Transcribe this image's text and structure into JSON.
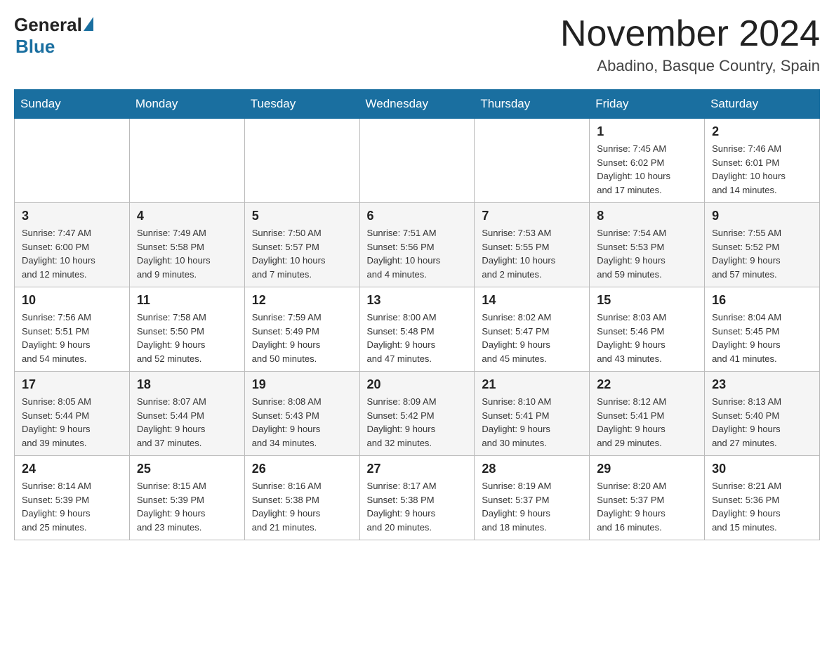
{
  "header": {
    "logo_general": "General",
    "logo_blue": "Blue",
    "month_title": "November 2024",
    "location": "Abadino, Basque Country, Spain"
  },
  "weekdays": [
    "Sunday",
    "Monday",
    "Tuesday",
    "Wednesday",
    "Thursday",
    "Friday",
    "Saturday"
  ],
  "rows": [
    [
      {
        "day": "",
        "info": ""
      },
      {
        "day": "",
        "info": ""
      },
      {
        "day": "",
        "info": ""
      },
      {
        "day": "",
        "info": ""
      },
      {
        "day": "",
        "info": ""
      },
      {
        "day": "1",
        "info": "Sunrise: 7:45 AM\nSunset: 6:02 PM\nDaylight: 10 hours\nand 17 minutes."
      },
      {
        "day": "2",
        "info": "Sunrise: 7:46 AM\nSunset: 6:01 PM\nDaylight: 10 hours\nand 14 minutes."
      }
    ],
    [
      {
        "day": "3",
        "info": "Sunrise: 7:47 AM\nSunset: 6:00 PM\nDaylight: 10 hours\nand 12 minutes."
      },
      {
        "day": "4",
        "info": "Sunrise: 7:49 AM\nSunset: 5:58 PM\nDaylight: 10 hours\nand 9 minutes."
      },
      {
        "day": "5",
        "info": "Sunrise: 7:50 AM\nSunset: 5:57 PM\nDaylight: 10 hours\nand 7 minutes."
      },
      {
        "day": "6",
        "info": "Sunrise: 7:51 AM\nSunset: 5:56 PM\nDaylight: 10 hours\nand 4 minutes."
      },
      {
        "day": "7",
        "info": "Sunrise: 7:53 AM\nSunset: 5:55 PM\nDaylight: 10 hours\nand 2 minutes."
      },
      {
        "day": "8",
        "info": "Sunrise: 7:54 AM\nSunset: 5:53 PM\nDaylight: 9 hours\nand 59 minutes."
      },
      {
        "day": "9",
        "info": "Sunrise: 7:55 AM\nSunset: 5:52 PM\nDaylight: 9 hours\nand 57 minutes."
      }
    ],
    [
      {
        "day": "10",
        "info": "Sunrise: 7:56 AM\nSunset: 5:51 PM\nDaylight: 9 hours\nand 54 minutes."
      },
      {
        "day": "11",
        "info": "Sunrise: 7:58 AM\nSunset: 5:50 PM\nDaylight: 9 hours\nand 52 minutes."
      },
      {
        "day": "12",
        "info": "Sunrise: 7:59 AM\nSunset: 5:49 PM\nDaylight: 9 hours\nand 50 minutes."
      },
      {
        "day": "13",
        "info": "Sunrise: 8:00 AM\nSunset: 5:48 PM\nDaylight: 9 hours\nand 47 minutes."
      },
      {
        "day": "14",
        "info": "Sunrise: 8:02 AM\nSunset: 5:47 PM\nDaylight: 9 hours\nand 45 minutes."
      },
      {
        "day": "15",
        "info": "Sunrise: 8:03 AM\nSunset: 5:46 PM\nDaylight: 9 hours\nand 43 minutes."
      },
      {
        "day": "16",
        "info": "Sunrise: 8:04 AM\nSunset: 5:45 PM\nDaylight: 9 hours\nand 41 minutes."
      }
    ],
    [
      {
        "day": "17",
        "info": "Sunrise: 8:05 AM\nSunset: 5:44 PM\nDaylight: 9 hours\nand 39 minutes."
      },
      {
        "day": "18",
        "info": "Sunrise: 8:07 AM\nSunset: 5:44 PM\nDaylight: 9 hours\nand 37 minutes."
      },
      {
        "day": "19",
        "info": "Sunrise: 8:08 AM\nSunset: 5:43 PM\nDaylight: 9 hours\nand 34 minutes."
      },
      {
        "day": "20",
        "info": "Sunrise: 8:09 AM\nSunset: 5:42 PM\nDaylight: 9 hours\nand 32 minutes."
      },
      {
        "day": "21",
        "info": "Sunrise: 8:10 AM\nSunset: 5:41 PM\nDaylight: 9 hours\nand 30 minutes."
      },
      {
        "day": "22",
        "info": "Sunrise: 8:12 AM\nSunset: 5:41 PM\nDaylight: 9 hours\nand 29 minutes."
      },
      {
        "day": "23",
        "info": "Sunrise: 8:13 AM\nSunset: 5:40 PM\nDaylight: 9 hours\nand 27 minutes."
      }
    ],
    [
      {
        "day": "24",
        "info": "Sunrise: 8:14 AM\nSunset: 5:39 PM\nDaylight: 9 hours\nand 25 minutes."
      },
      {
        "day": "25",
        "info": "Sunrise: 8:15 AM\nSunset: 5:39 PM\nDaylight: 9 hours\nand 23 minutes."
      },
      {
        "day": "26",
        "info": "Sunrise: 8:16 AM\nSunset: 5:38 PM\nDaylight: 9 hours\nand 21 minutes."
      },
      {
        "day": "27",
        "info": "Sunrise: 8:17 AM\nSunset: 5:38 PM\nDaylight: 9 hours\nand 20 minutes."
      },
      {
        "day": "28",
        "info": "Sunrise: 8:19 AM\nSunset: 5:37 PM\nDaylight: 9 hours\nand 18 minutes."
      },
      {
        "day": "29",
        "info": "Sunrise: 8:20 AM\nSunset: 5:37 PM\nDaylight: 9 hours\nand 16 minutes."
      },
      {
        "day": "30",
        "info": "Sunrise: 8:21 AM\nSunset: 5:36 PM\nDaylight: 9 hours\nand 15 minutes."
      }
    ]
  ]
}
